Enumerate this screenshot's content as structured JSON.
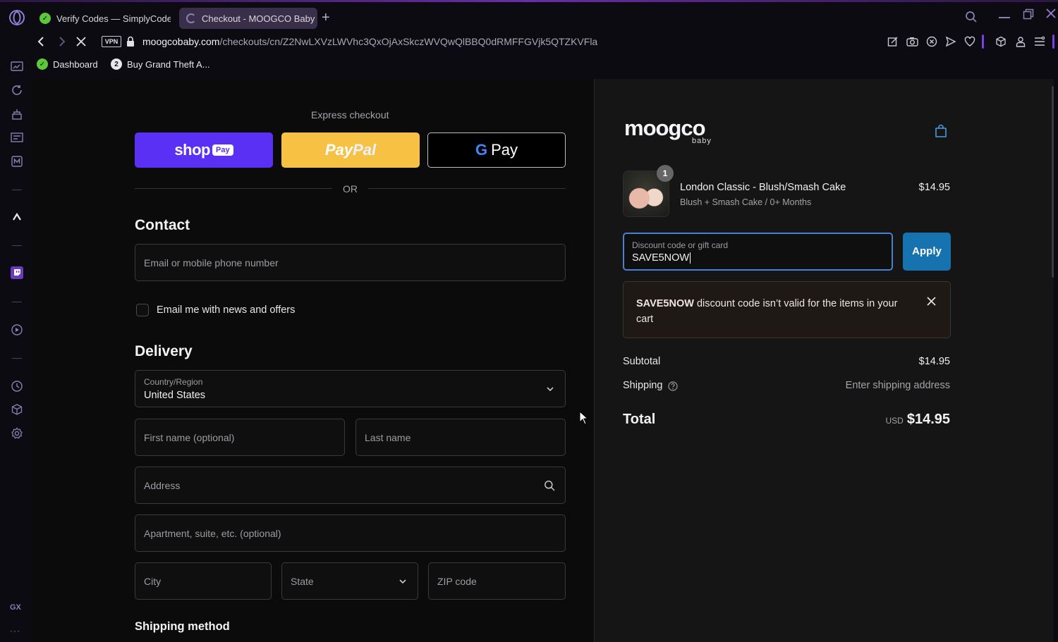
{
  "browser": {
    "tabs": [
      {
        "title": "Verify Codes — SimplyCodes",
        "active": false
      },
      {
        "title": "Checkout - MOOGCO Baby",
        "active": true
      }
    ],
    "url_domain": "moogcobaby.com",
    "url_path": "/checkouts/cn/Z2NwLXVzLWVhc3QxOjAxSkczWVQwQlBBQ0dRMFFGVjk5QTZKVFla",
    "vpn_label": "VPN",
    "bookmarks": [
      {
        "label": "Dashboard"
      },
      {
        "label": "Buy Grand Theft A..."
      }
    ],
    "sidebar_bottom_label": "GX",
    "sidebar_more": "···",
    "notification_count": "2"
  },
  "checkout": {
    "express_label": "Express checkout",
    "shop_pay": {
      "shop": "shop",
      "pay": "Pay"
    },
    "paypal": {
      "pay": "Pay",
      "pal": "Pal"
    },
    "gpay": {
      "g": "G",
      "pay": "Pay"
    },
    "or_label": "OR",
    "contact_heading": "Contact",
    "email_placeholder": "Email or mobile phone number",
    "newsletter_label": "Email me with news and offers",
    "newsletter_checked": false,
    "delivery_heading": "Delivery",
    "country_label": "Country/Region",
    "country_value": "United States",
    "first_name_placeholder": "First name (optional)",
    "last_name_placeholder": "Last name",
    "address_placeholder": "Address",
    "apartment_placeholder": "Apartment, suite, etc. (optional)",
    "city_placeholder": "City",
    "state_placeholder": "State",
    "zip_placeholder": "ZIP code",
    "shipping_method_heading": "Shipping method"
  },
  "summary": {
    "logo_text": "moogco",
    "logo_sub": "baby",
    "item": {
      "quantity": "1",
      "name": "London Classic - Blush/Smash Cake",
      "variant": "Blush + Smash Cake / 0+ Months",
      "price": "$14.95"
    },
    "discount_label": "Discount code or gift card",
    "discount_value": "SAVE5NOW",
    "apply_label": "Apply",
    "error_code": "SAVE5NOW",
    "error_message": " discount code isn’t valid for the items in your cart",
    "subtotal_label": "Subtotal",
    "subtotal_value": "$14.95",
    "shipping_label": "Shipping",
    "shipping_value": "Enter shipping address",
    "total_label": "Total",
    "total_currency": "USD",
    "total_value": "$14.95"
  },
  "colors": {
    "shop_pay": "#5a31f4",
    "paypal": "#f7c244",
    "apply": "#1773b0",
    "accent": "#7b3fe4"
  }
}
